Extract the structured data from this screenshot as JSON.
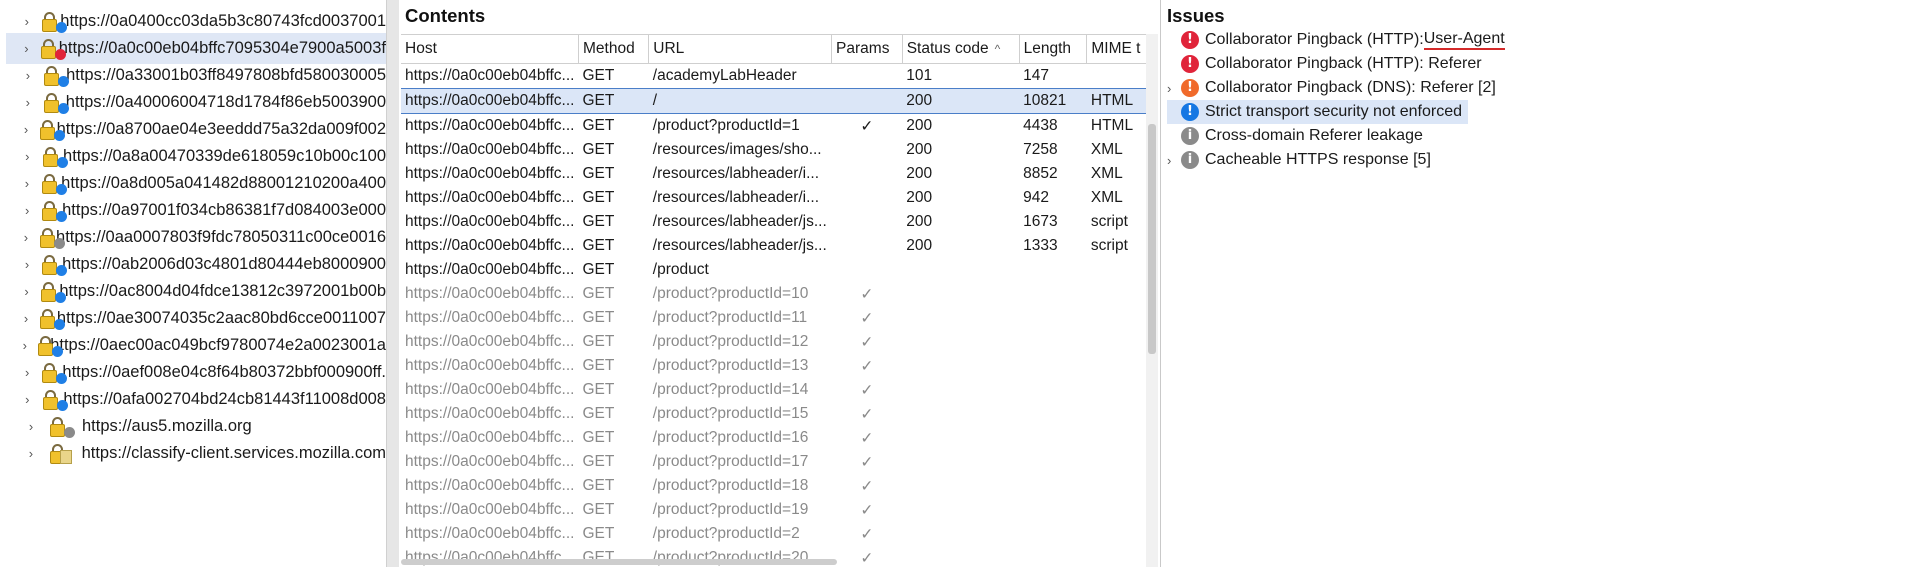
{
  "colors": {
    "high": "#e0243a",
    "medium": "#f06a2b",
    "info": "#1577e3",
    "muted": "#8a8a8a",
    "red_dot": "#e0243a",
    "blue_dot": "#1f7fe6",
    "gray_dot": "#8a8a8a"
  },
  "tree": {
    "items": [
      {
        "label": "https://0a0400cc03da5b3c80743fcd0037001",
        "dot": "blue_dot",
        "icon": "lock",
        "selected": false
      },
      {
        "label": "https://0a0c00eb04bffc7095304e7900a5003f",
        "dot": "red_dot",
        "icon": "lock",
        "selected": true
      },
      {
        "label": "https://0a33001b03ff8497808bfd580030005",
        "dot": "blue_dot",
        "icon": "lock",
        "selected": false
      },
      {
        "label": "https://0a40006004718d1784f86eb5003900",
        "dot": "blue_dot",
        "icon": "lock",
        "selected": false
      },
      {
        "label": "https://0a8700ae04e3eeddd75a32da009f002",
        "dot": "blue_dot",
        "icon": "lock",
        "selected": false
      },
      {
        "label": "https://0a8a00470339de618059c10b00c100",
        "dot": "blue_dot",
        "icon": "lock",
        "selected": false
      },
      {
        "label": "https://0a8d005a041482d88001210200a400",
        "dot": "blue_dot",
        "icon": "lock",
        "selected": false
      },
      {
        "label": "https://0a97001f034cb86381f7d084003e000",
        "dot": "blue_dot",
        "icon": "lock",
        "selected": false
      },
      {
        "label": "https://0aa0007803f9fdc78050311c00ce0016",
        "dot": "gray_dot",
        "icon": "lock",
        "selected": false
      },
      {
        "label": "https://0ab2006d03c4801d80444eb8000900",
        "dot": "blue_dot",
        "icon": "lock",
        "selected": false
      },
      {
        "label": "https://0ac8004d04fdce13812c3972001b00b",
        "dot": "blue_dot",
        "icon": "lock",
        "selected": false
      },
      {
        "label": "https://0ae30074035c2aac80bd6cce0011007",
        "dot": "blue_dot",
        "icon": "lock",
        "selected": false
      },
      {
        "label": "https://0aec00ac049bcf9780074e2a0023001a",
        "dot": "blue_dot",
        "icon": "lock",
        "selected": false
      },
      {
        "label": "https://0aef008e04c8f64b80372bbf000900ff.",
        "dot": "blue_dot",
        "icon": "lock",
        "selected": false
      },
      {
        "label": "https://0afa002704bd24cb81443f11008d008",
        "dot": "blue_dot",
        "icon": "lock",
        "selected": false
      },
      {
        "label": "https://aus5.mozilla.org",
        "dot": "gray_dot",
        "icon": "lock",
        "selected": false
      },
      {
        "label": "https://classify-client.services.mozilla.com",
        "dot": "none",
        "icon": "lock",
        "selected": false
      }
    ]
  },
  "contents": {
    "title": "Contents",
    "columns": [
      "Host",
      "Method",
      "URL",
      "Params",
      "Status code",
      "Length",
      "MIME t"
    ],
    "sort_indicator": "^",
    "rows": [
      {
        "host": "https://0a0c00eb04bffc...",
        "method": "GET",
        "url": "/academyLabHeader",
        "params": "",
        "status": "101",
        "length": "147",
        "mime": "",
        "dim": false,
        "selected": false
      },
      {
        "host": "https://0a0c00eb04bffc...",
        "method": "GET",
        "url": "/",
        "params": "",
        "status": "200",
        "length": "10821",
        "mime": "HTML",
        "dim": false,
        "selected": true
      },
      {
        "host": "https://0a0c00eb04bffc...",
        "method": "GET",
        "url": "/product?productId=1",
        "params": "✓",
        "status": "200",
        "length": "4438",
        "mime": "HTML",
        "dim": false,
        "selected": false
      },
      {
        "host": "https://0a0c00eb04bffc...",
        "method": "GET",
        "url": "/resources/images/sho...",
        "params": "",
        "status": "200",
        "length": "7258",
        "mime": "XML",
        "dim": false,
        "selected": false
      },
      {
        "host": "https://0a0c00eb04bffc...",
        "method": "GET",
        "url": "/resources/labheader/i...",
        "params": "",
        "status": "200",
        "length": "8852",
        "mime": "XML",
        "dim": false,
        "selected": false
      },
      {
        "host": "https://0a0c00eb04bffc...",
        "method": "GET",
        "url": "/resources/labheader/i...",
        "params": "",
        "status": "200",
        "length": "942",
        "mime": "XML",
        "dim": false,
        "selected": false
      },
      {
        "host": "https://0a0c00eb04bffc...",
        "method": "GET",
        "url": "/resources/labheader/js...",
        "params": "",
        "status": "200",
        "length": "1673",
        "mime": "script",
        "dim": false,
        "selected": false
      },
      {
        "host": "https://0a0c00eb04bffc...",
        "method": "GET",
        "url": "/resources/labheader/js...",
        "params": "",
        "status": "200",
        "length": "1333",
        "mime": "script",
        "dim": false,
        "selected": false
      },
      {
        "host": "https://0a0c00eb04bffc...",
        "method": "GET",
        "url": "/product",
        "params": "",
        "status": "",
        "length": "",
        "mime": "",
        "dim": false,
        "selected": false
      },
      {
        "host": "https://0a0c00eb04bffc...",
        "method": "GET",
        "url": "/product?productId=10",
        "params": "✓",
        "status": "",
        "length": "",
        "mime": "",
        "dim": true,
        "selected": false
      },
      {
        "host": "https://0a0c00eb04bffc...",
        "method": "GET",
        "url": "/product?productId=11",
        "params": "✓",
        "status": "",
        "length": "",
        "mime": "",
        "dim": true,
        "selected": false
      },
      {
        "host": "https://0a0c00eb04bffc...",
        "method": "GET",
        "url": "/product?productId=12",
        "params": "✓",
        "status": "",
        "length": "",
        "mime": "",
        "dim": true,
        "selected": false
      },
      {
        "host": "https://0a0c00eb04bffc...",
        "method": "GET",
        "url": "/product?productId=13",
        "params": "✓",
        "status": "",
        "length": "",
        "mime": "",
        "dim": true,
        "selected": false
      },
      {
        "host": "https://0a0c00eb04bffc...",
        "method": "GET",
        "url": "/product?productId=14",
        "params": "✓",
        "status": "",
        "length": "",
        "mime": "",
        "dim": true,
        "selected": false
      },
      {
        "host": "https://0a0c00eb04bffc...",
        "method": "GET",
        "url": "/product?productId=15",
        "params": "✓",
        "status": "",
        "length": "",
        "mime": "",
        "dim": true,
        "selected": false
      },
      {
        "host": "https://0a0c00eb04bffc...",
        "method": "GET",
        "url": "/product?productId=16",
        "params": "✓",
        "status": "",
        "length": "",
        "mime": "",
        "dim": true,
        "selected": false
      },
      {
        "host": "https://0a0c00eb04bffc...",
        "method": "GET",
        "url": "/product?productId=17",
        "params": "✓",
        "status": "",
        "length": "",
        "mime": "",
        "dim": true,
        "selected": false
      },
      {
        "host": "https://0a0c00eb04bffc...",
        "method": "GET",
        "url": "/product?productId=18",
        "params": "✓",
        "status": "",
        "length": "",
        "mime": "",
        "dim": true,
        "selected": false
      },
      {
        "host": "https://0a0c00eb04bffc...",
        "method": "GET",
        "url": "/product?productId=19",
        "params": "✓",
        "status": "",
        "length": "",
        "mime": "",
        "dim": true,
        "selected": false
      },
      {
        "host": "https://0a0c00eb04bffc...",
        "method": "GET",
        "url": "/product?productId=2",
        "params": "✓",
        "status": "",
        "length": "",
        "mime": "",
        "dim": true,
        "selected": false
      },
      {
        "host": "https://0a0c00eb04bffc...",
        "method": "GET",
        "url": "/product?productId=20",
        "params": "✓",
        "status": "",
        "length": "",
        "mime": "",
        "dim": true,
        "selected": false
      }
    ]
  },
  "issues": {
    "title": "Issues",
    "items": [
      {
        "prefix": "Collaborator Pingback (HTTP): ",
        "highlight": "User-Agent",
        "suffix": "",
        "severity": "high",
        "expandable": false,
        "selected": false,
        "underline": true
      },
      {
        "prefix": "Collaborator Pingback (HTTP): Referer",
        "highlight": "",
        "suffix": "",
        "severity": "high",
        "expandable": false,
        "selected": false,
        "underline": false
      },
      {
        "prefix": "Collaborator Pingback (DNS): Referer [2]",
        "highlight": "",
        "suffix": "",
        "severity": "medium",
        "expandable": true,
        "selected": false,
        "underline": false
      },
      {
        "prefix": "Strict transport security not enforced",
        "highlight": "",
        "suffix": "",
        "severity": "info",
        "expandable": false,
        "selected": true,
        "underline": false
      },
      {
        "prefix": "Cross-domain Referer leakage",
        "highlight": "",
        "suffix": "",
        "severity": "muted",
        "expandable": false,
        "selected": false,
        "underline": false
      },
      {
        "prefix": "Cacheable HTTPS response [5]",
        "highlight": "",
        "suffix": "",
        "severity": "muted",
        "expandable": true,
        "selected": false,
        "underline": false
      }
    ]
  }
}
